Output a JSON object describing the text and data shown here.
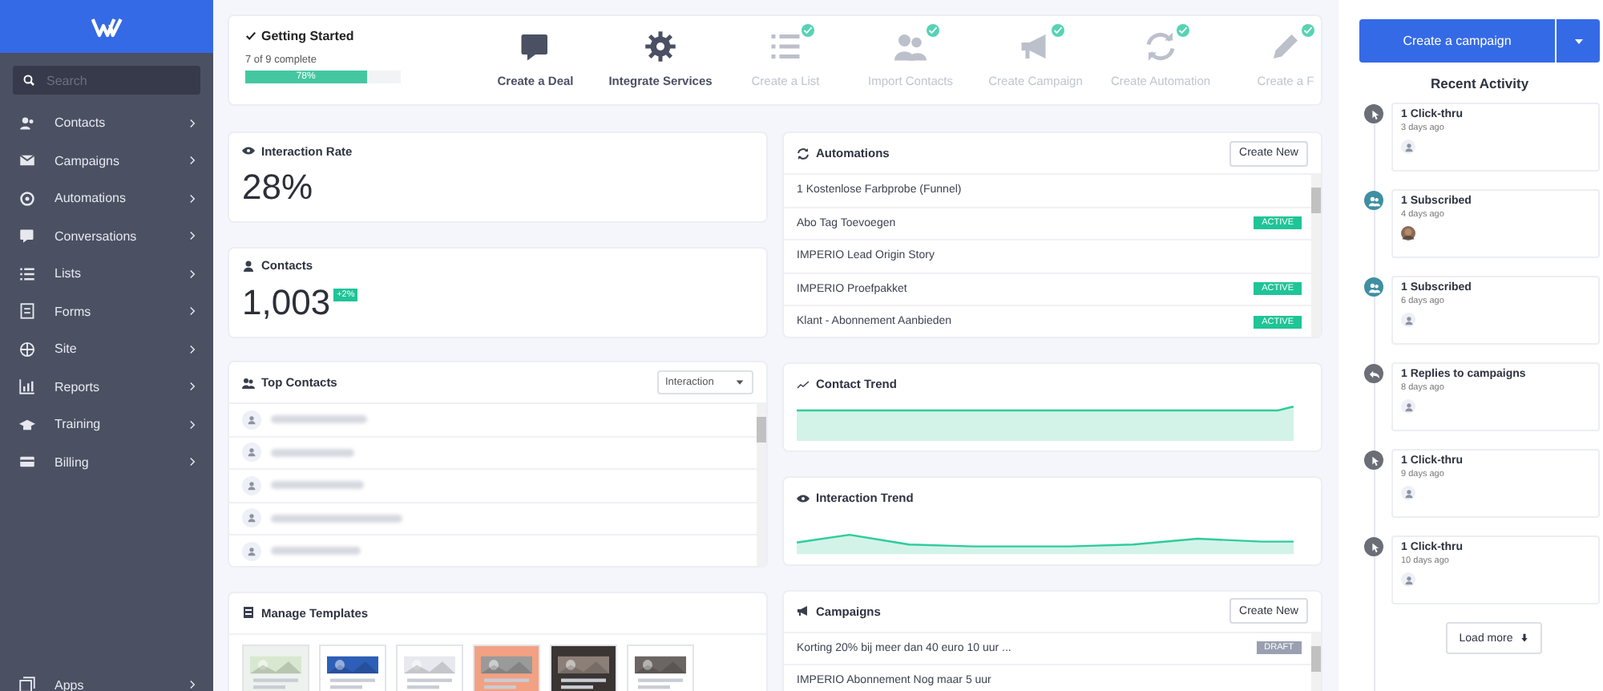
{
  "sidebar": {
    "search": {
      "placeholder": "Search"
    },
    "items": [
      {
        "label": "Contacts"
      },
      {
        "label": "Campaigns"
      },
      {
        "label": "Automations"
      },
      {
        "label": "Conversations"
      },
      {
        "label": "Lists"
      },
      {
        "label": "Forms"
      },
      {
        "label": "Site"
      },
      {
        "label": "Reports"
      },
      {
        "label": "Training"
      },
      {
        "label": "Billing"
      }
    ],
    "footer_item": {
      "label": "Apps"
    }
  },
  "getting_started": {
    "title": "Getting Started",
    "progress_text": "7 of 9 complete",
    "level": 0.78,
    "progress_label": "78%",
    "steps": [
      {
        "label": "Create a Deal",
        "done": false
      },
      {
        "label": "Integrate Services",
        "done": false
      },
      {
        "label": "Create a List",
        "done": true
      },
      {
        "label": "Import Contacts",
        "done": true
      },
      {
        "label": "Create Campaign",
        "done": true
      },
      {
        "label": "Create Automation",
        "done": true
      },
      {
        "label": "Create a F",
        "done": true
      }
    ]
  },
  "interaction_rate": {
    "title": "Interaction Rate",
    "value": "28%"
  },
  "contacts": {
    "title": "Contacts",
    "value": "1,003",
    "badge": "+2%"
  },
  "top_contacts": {
    "title": "Top Contacts",
    "sort": "Interaction"
  },
  "automations": {
    "title": "Automations",
    "button": "Create New",
    "items": [
      {
        "name": "1 Kostenlose Farbprobe (Funnel)"
      },
      {
        "name": "Abo Tag Toevoegen",
        "status": "ACTIVE"
      },
      {
        "name": "IMPERIO Lead Origin Story"
      },
      {
        "name": "IMPERIO Proefpakket",
        "status": "ACTIVE"
      },
      {
        "name": "Klant - Abonnement Aanbieden",
        "status": "ACTIVE"
      }
    ]
  },
  "contact_trend": {
    "title": "Contact Trend"
  },
  "interaction_trend": {
    "title": "Interaction Trend"
  },
  "templates": {
    "title": "Manage Templates"
  },
  "campaigns": {
    "title": "Campaigns",
    "button": "Create New",
    "items": [
      {
        "name": "Korting 20% bij meer dan 40 euro 10 uur ...",
        "status": "DRAFT"
      },
      {
        "name": "IMPERIO Abonnement Nog maar 5 uur"
      }
    ]
  },
  "activity": {
    "button": "Create a campaign",
    "title": "Recent Activity",
    "load_more": "Load more",
    "items": [
      {
        "label": "1 Click-thru",
        "time": "3 days ago",
        "kind": "click",
        "photo": false
      },
      {
        "label": "1 Subscribed",
        "time": "4 days ago",
        "kind": "subscribe",
        "photo": true
      },
      {
        "label": "1 Subscribed",
        "time": "6 days ago",
        "kind": "subscribe",
        "photo": false
      },
      {
        "label": "1 Replies to campaigns",
        "time": "8 days ago",
        "kind": "reply",
        "photo": false
      },
      {
        "label": "1 Click-thru",
        "time": "9 days ago",
        "kind": "click",
        "photo": false
      },
      {
        "label": "1 Click-thru",
        "time": "10 days ago",
        "kind": "click",
        "photo": false
      }
    ]
  }
}
